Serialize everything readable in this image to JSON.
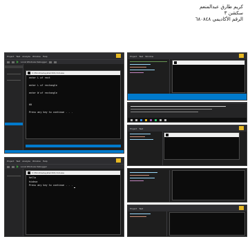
{
  "header": {
    "name": "كريم طارق عبدالمنعم",
    "section": "سكشن ٣",
    "academic_id": "الرقم الأكاديمي ٦٨٠٨٤٨"
  },
  "vs_menu": {
    "items": [
      "Project",
      "Test",
      "Analyze",
      "Window",
      "Help"
    ],
    "debugger_label": "Local Windows Debugger"
  },
  "console_top_left": {
    "title": "C:\\Windows\\system32\\cmd.exe",
    "lines": [
      "enter L of rect",
      "",
      "enter L of rectangle",
      "",
      "enter W of rectangle",
      "",
      "",
      "60",
      "",
      "Press any key to continue . . ."
    ]
  },
  "console_bottom_left": {
    "title": "C:\\Windows\\system32\\cmd.exe",
    "lines": [
      "hello",
      "hiubsa",
      "Press any key to continue . . ."
    ]
  },
  "status_items": [
    "Build",
    "Output",
    "Error List",
    "Ready"
  ],
  "colors": {
    "vs_blue": "#007acc",
    "vs_dark": "#1e1e1e",
    "accent_yellow": "#e8b923"
  }
}
